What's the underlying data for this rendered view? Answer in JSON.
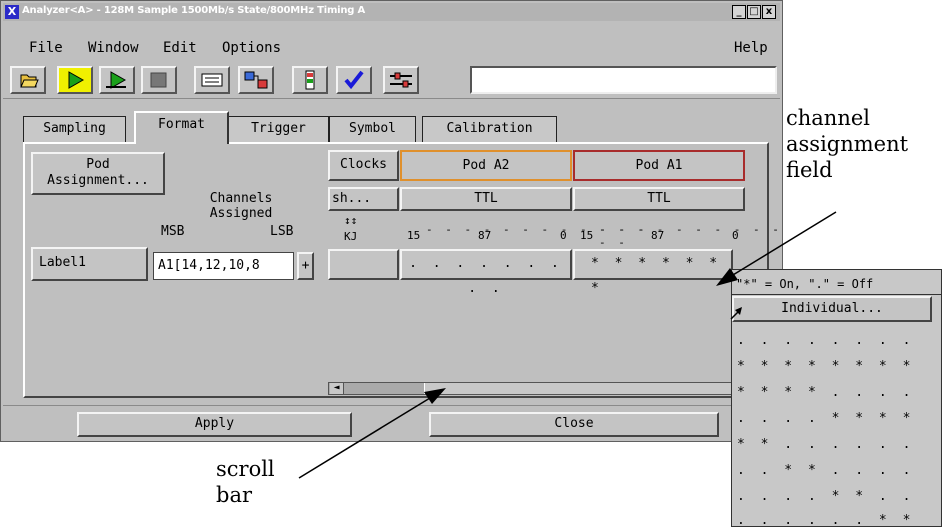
{
  "window": {
    "title": "Analyzer<A> - 128M Sample 1500Mb/s State/800MHz Timing A",
    "title_icon": "X",
    "controls": [
      "_",
      "□",
      "x"
    ]
  },
  "menubar": {
    "file": "File",
    "window": "Window",
    "edit": "Edit",
    "options": "Options",
    "help": "Help"
  },
  "toolbar": {
    "icons": [
      "open-folder-icon",
      "run-single-icon",
      "run-repetitive-icon",
      "stop-icon",
      "listing-icon",
      "waveform-icon",
      "chart-icon",
      "checkmark-icon",
      "settings-icon"
    ],
    "field_value": ""
  },
  "tabs": [
    "Sampling",
    "Format",
    "Trigger",
    "Symbol",
    "Calibration"
  ],
  "format": {
    "pod_assignment": "Pod\nAssignment...",
    "channels_assigned": "Channels\nAssigned",
    "msb": "MSB",
    "lsb": "LSB",
    "clocks": "Clocks",
    "sh": "sh...",
    "kj": "KJ",
    "arrows": "↕↕",
    "pods": [
      {
        "name": "Pod A2",
        "type": "TTL",
        "bits": [
          "15",
          "87",
          "0"
        ],
        "assignment": ". . . . . . . . ."
      },
      {
        "name": "Pod A1",
        "type": "TTL",
        "bits": [
          "15",
          "87",
          "0"
        ],
        "assignment": "* * * * * * *"
      }
    ],
    "label_name": "Label1",
    "label_channels": "A1[14,12,10,8",
    "plus": "+"
  },
  "footer": {
    "apply": "Apply",
    "close": "Close"
  },
  "popup": {
    "legend": "\"*\" = On, \".\" = Off",
    "individual": "Individual...",
    "options": [
      ". . . . . . . .",
      "* * * * * * * *",
      "* * * * . . . .",
      ". . . . * * * *",
      "* * . . . . . .",
      ". . * * . . . .",
      ". . . . * * . .",
      ". . . . . . * *"
    ]
  },
  "annotations": {
    "channel_field": [
      "channel",
      "assignment",
      "field"
    ],
    "scroll_bar": [
      "scroll",
      "bar"
    ]
  }
}
